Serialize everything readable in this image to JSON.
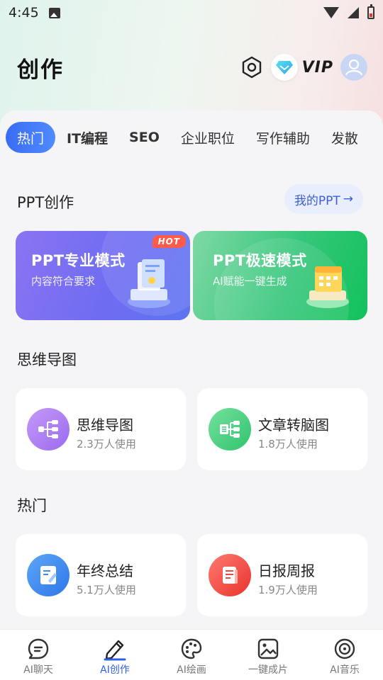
{
  "status_bar": {
    "time": "4:45"
  },
  "header": {
    "title": "创作",
    "vip_label": "VIP"
  },
  "tabs": [
    {
      "label": "热门",
      "active": true
    },
    {
      "label": "IT编程",
      "active": false
    },
    {
      "label": "SEO",
      "active": false
    },
    {
      "label": "企业职位",
      "active": false
    },
    {
      "label": "写作辅助",
      "active": false
    },
    {
      "label": "发散",
      "active": false
    }
  ],
  "ppt_section": {
    "title": "PPT创作",
    "my_ppt_label": "我的PPT",
    "cards": [
      {
        "title": "PPT专业模式",
        "subtitle": "内容符合要求",
        "badge": "HOT"
      },
      {
        "title": "PPT极速模式",
        "subtitle": "AI赋能一键生成"
      }
    ]
  },
  "mindmap_section": {
    "title": "思维导图",
    "items": [
      {
        "name": "思维导图",
        "usage": "2.3万人使用",
        "icon": "mindmap-icon"
      },
      {
        "name": "文章转脑图",
        "usage": "1.8万人使用",
        "icon": "article-to-mindmap-icon"
      }
    ]
  },
  "hot_section": {
    "title": "热门",
    "items": [
      {
        "name": "年终总结",
        "usage": "5.1万人使用",
        "icon": "year-summary-icon"
      },
      {
        "name": "日报周报",
        "usage": "1.9万人使用",
        "icon": "daily-report-icon"
      }
    ]
  },
  "bottom_nav": [
    {
      "label": "AI聊天",
      "icon": "chat-icon",
      "active": false
    },
    {
      "label": "AI创作",
      "icon": "pen-icon",
      "active": true
    },
    {
      "label": "AI绘画",
      "icon": "palette-icon",
      "active": false
    },
    {
      "label": "一键成片",
      "icon": "image-icon",
      "active": false
    },
    {
      "label": "AI音乐",
      "icon": "music-disc-icon",
      "active": false
    }
  ],
  "colors": {
    "accent": "#2f5fe8",
    "ppt_pro": "#7a6ff2",
    "ppt_fast": "#2ec56f",
    "mindmap_icon": "#a877f0",
    "article_icon": "#3fcc7a",
    "summary_icon": "#3d8bf0",
    "report_icon": "#f0453e"
  }
}
